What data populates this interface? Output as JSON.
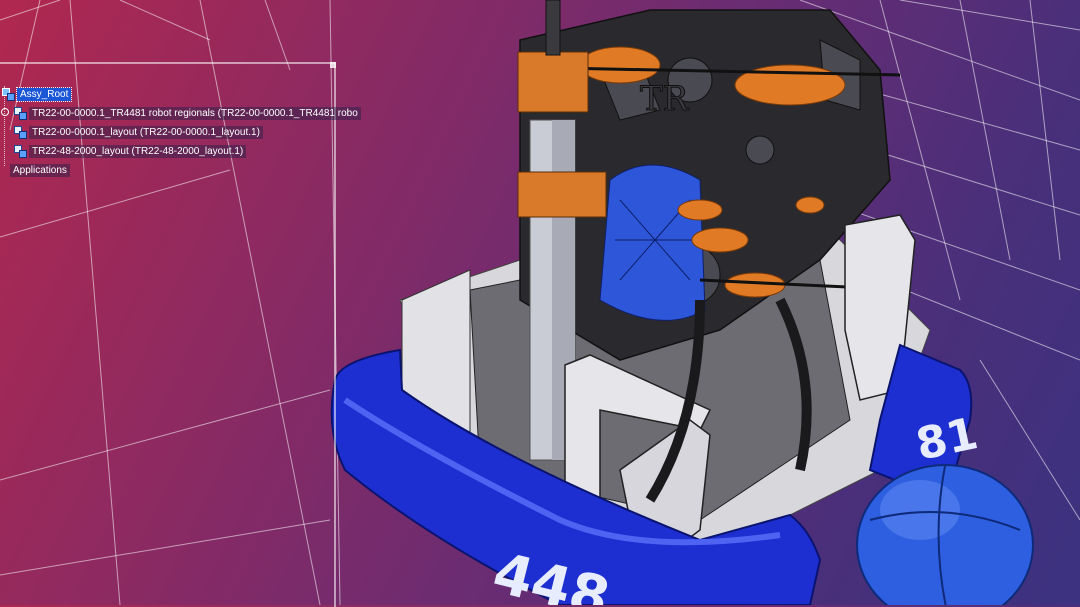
{
  "specification_tree": {
    "root": {
      "label": "Assy_Root",
      "icon": "assembly-icon"
    },
    "items": [
      {
        "label": "TR22-00-0000.1_TR4481 robot regionals (TR22-00-0000.1_TR4481 robo",
        "icon": "product-icon"
      },
      {
        "label": "TR22-00-0000.1_layout (TR22-00-0000.1_layout.1)",
        "icon": "product-icon"
      },
      {
        "label": "TR22-48-2000_layout (TR22-48-2000_layout.1)",
        "icon": "product-icon"
      }
    ],
    "applications_label": "Applications"
  },
  "model": {
    "team_number_front": "448",
    "team_number_side": "81",
    "logo_text": "TR",
    "colors": {
      "background_top": "#b0284f",
      "background_bottom": "#3b3280",
      "bumper_blue": "#1d2fd0",
      "frame_dark": "#2a2a2e",
      "accent_orange": "#e07a25",
      "metal_silver": "#c9ccd4",
      "ball_blue": "#2d5fe0",
      "grid_line": "#ffffff"
    }
  }
}
